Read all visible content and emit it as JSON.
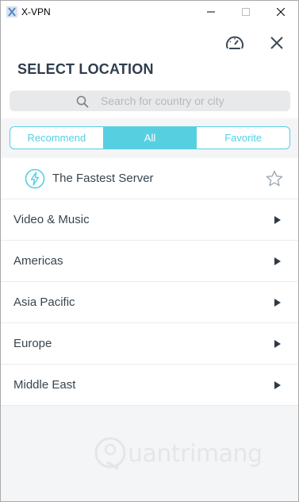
{
  "window": {
    "title": "X-VPN"
  },
  "header": {
    "title": "SELECT LOCATION",
    "search_placeholder": "Search for country or city"
  },
  "tabs": [
    {
      "label": "Recommend",
      "active": false
    },
    {
      "label": "All",
      "active": true
    },
    {
      "label": "Favorite",
      "active": false
    }
  ],
  "list": {
    "fastest": {
      "label": "The Fastest Server",
      "icon": "lightning-icon",
      "fav_icon": "star-icon"
    },
    "regions": [
      {
        "label": "Video & Music"
      },
      {
        "label": "Americas"
      },
      {
        "label": "Asia Pacific"
      },
      {
        "label": "Europe"
      },
      {
        "label": "Middle East"
      }
    ]
  },
  "watermark": {
    "text": "uantrimang"
  },
  "colors": {
    "accent": "#56cfe1",
    "title": "#2f3d4c",
    "text": "#39444f"
  }
}
